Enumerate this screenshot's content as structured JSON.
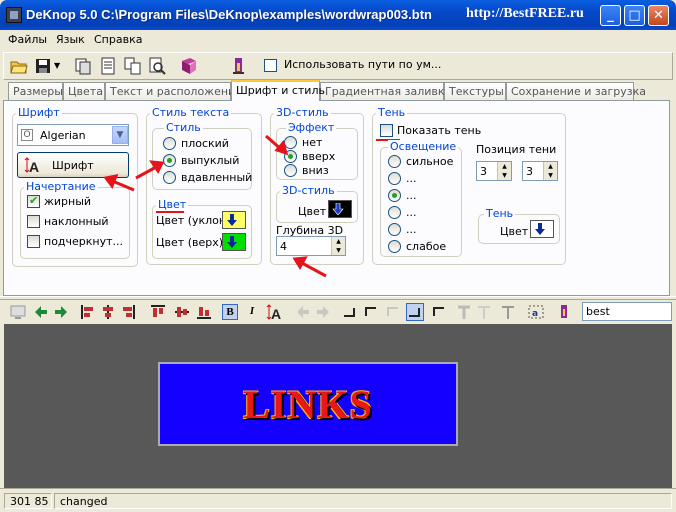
{
  "window": {
    "title": "DeKnop 5.0 C:\\Program Files\\DeKnop\\examples\\wordwrap003.btn",
    "watermark": "http://BestFREE.ru"
  },
  "menu": [
    "Файлы",
    "Язык",
    "Справка"
  ],
  "toolbar": {
    "use_paths_label": "Использовать пути по ум...",
    "use_paths_checked": false
  },
  "tabs": [
    "Размеры",
    "Цвета",
    "Текст и расположение",
    "Шрифт и стиль",
    "Градиентная заливка",
    "Текстуры",
    "Сохранение и загрузка"
  ],
  "active_tab": "Шрифт и стиль",
  "font": {
    "group_title": "Шрифт",
    "font_name": "Algerian",
    "font_button_label": "Шрифт",
    "style_group_title": "Начертание",
    "bold_label": "жирный",
    "bold_checked": true,
    "italic_label": "наклонный",
    "italic_checked": false,
    "underline_label": "подчеркнут...",
    "underline_checked": false
  },
  "text_style": {
    "group_title": "Стиль текста",
    "style_title": "Стиль",
    "options": [
      "плоский",
      "выпуклый",
      "вдавленный"
    ],
    "selected": "выпуклый",
    "color_title": "Цвет",
    "color_slope_label": "Цвет (уклон)",
    "color_top_label": "Цвет (верх)"
  },
  "style_3d": {
    "group_title": "3D-стиль",
    "effect_title": "Эффект",
    "effect_options": [
      "нет",
      "вверх",
      "вниз"
    ],
    "effect_selected": "вверх",
    "color_group_title": "3D-стиль",
    "color_label": "Цвет",
    "depth_label": "Глубина 3D",
    "depth_value": "4"
  },
  "shadow": {
    "group_title": "Тень",
    "show_label": "Показать тень",
    "show_checked": false,
    "light_title": "Освещение",
    "light_options": [
      "сильное",
      "...",
      "...",
      "...",
      "...",
      "слабое"
    ],
    "light_selected_index": 2,
    "position_label": "Позиция тени",
    "pos_x": "3",
    "pos_y": "3",
    "shadow_group_title": "Тень",
    "color_label": "Цвет"
  },
  "colors": {
    "slope_swatch": "#ffff66",
    "top_swatch": "#00e000",
    "color3d_swatch": "#000000",
    "shadow_swatch": "#ffffff",
    "button_bg": "#1400ff",
    "button_text": "#e81818",
    "preview_bg": "#585858"
  },
  "editor": {
    "text_value": "best"
  },
  "preview": {
    "button_text": "LINKS"
  },
  "status": {
    "coords": "301 85",
    "state": "changed"
  }
}
